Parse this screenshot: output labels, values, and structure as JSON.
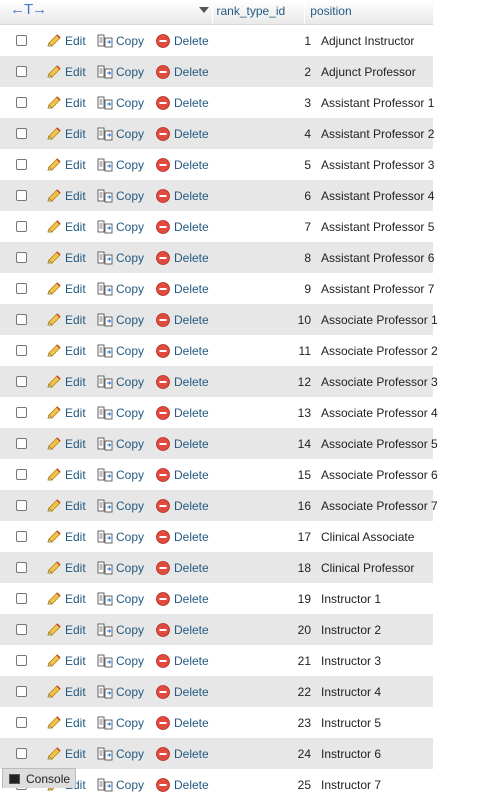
{
  "header": {
    "columns": [
      {
        "label": "rank_type_id"
      },
      {
        "label": "position"
      }
    ]
  },
  "actions": {
    "edit": "Edit",
    "copy": "Copy",
    "delete": "Delete"
  },
  "rows": [
    {
      "id": "1",
      "position": "Adjunct Instructor"
    },
    {
      "id": "2",
      "position": "Adjunct Professor"
    },
    {
      "id": "3",
      "position": "Assistant Professor 1"
    },
    {
      "id": "4",
      "position": "Assistant Professor 2"
    },
    {
      "id": "5",
      "position": "Assistant Professor 3"
    },
    {
      "id": "6",
      "position": "Assistant Professor 4"
    },
    {
      "id": "7",
      "position": "Assistant Professor 5"
    },
    {
      "id": "8",
      "position": "Assistant Professor 6"
    },
    {
      "id": "9",
      "position": "Assistant Professor 7"
    },
    {
      "id": "10",
      "position": "Associate Professor 1"
    },
    {
      "id": "11",
      "position": "Associate Professor 2"
    },
    {
      "id": "12",
      "position": "Associate Professor 3"
    },
    {
      "id": "13",
      "position": "Associate Professor 4"
    },
    {
      "id": "14",
      "position": "Associate Professor 5"
    },
    {
      "id": "15",
      "position": "Associate Professor 6"
    },
    {
      "id": "16",
      "position": "Associate Professor 7"
    },
    {
      "id": "17",
      "position": "Clinical Associate"
    },
    {
      "id": "18",
      "position": "Clinical Professor"
    },
    {
      "id": "19",
      "position": "Instructor 1"
    },
    {
      "id": "20",
      "position": "Instructor 2"
    },
    {
      "id": "21",
      "position": "Instructor 3"
    },
    {
      "id": "22",
      "position": "Instructor 4"
    },
    {
      "id": "23",
      "position": "Instructor 5"
    },
    {
      "id": "24",
      "position": "Instructor 6"
    },
    {
      "id": "25",
      "position": "Instructor 7"
    }
  ],
  "console": {
    "label": "Console"
  },
  "icons": {
    "edit": "pencil-icon",
    "copy": "copy-icon",
    "delete": "delete-icon",
    "console": "console-icon"
  },
  "colors": {
    "link": "#235a81",
    "row_alt": "#e7e7e7",
    "delete": "#d9534f"
  }
}
